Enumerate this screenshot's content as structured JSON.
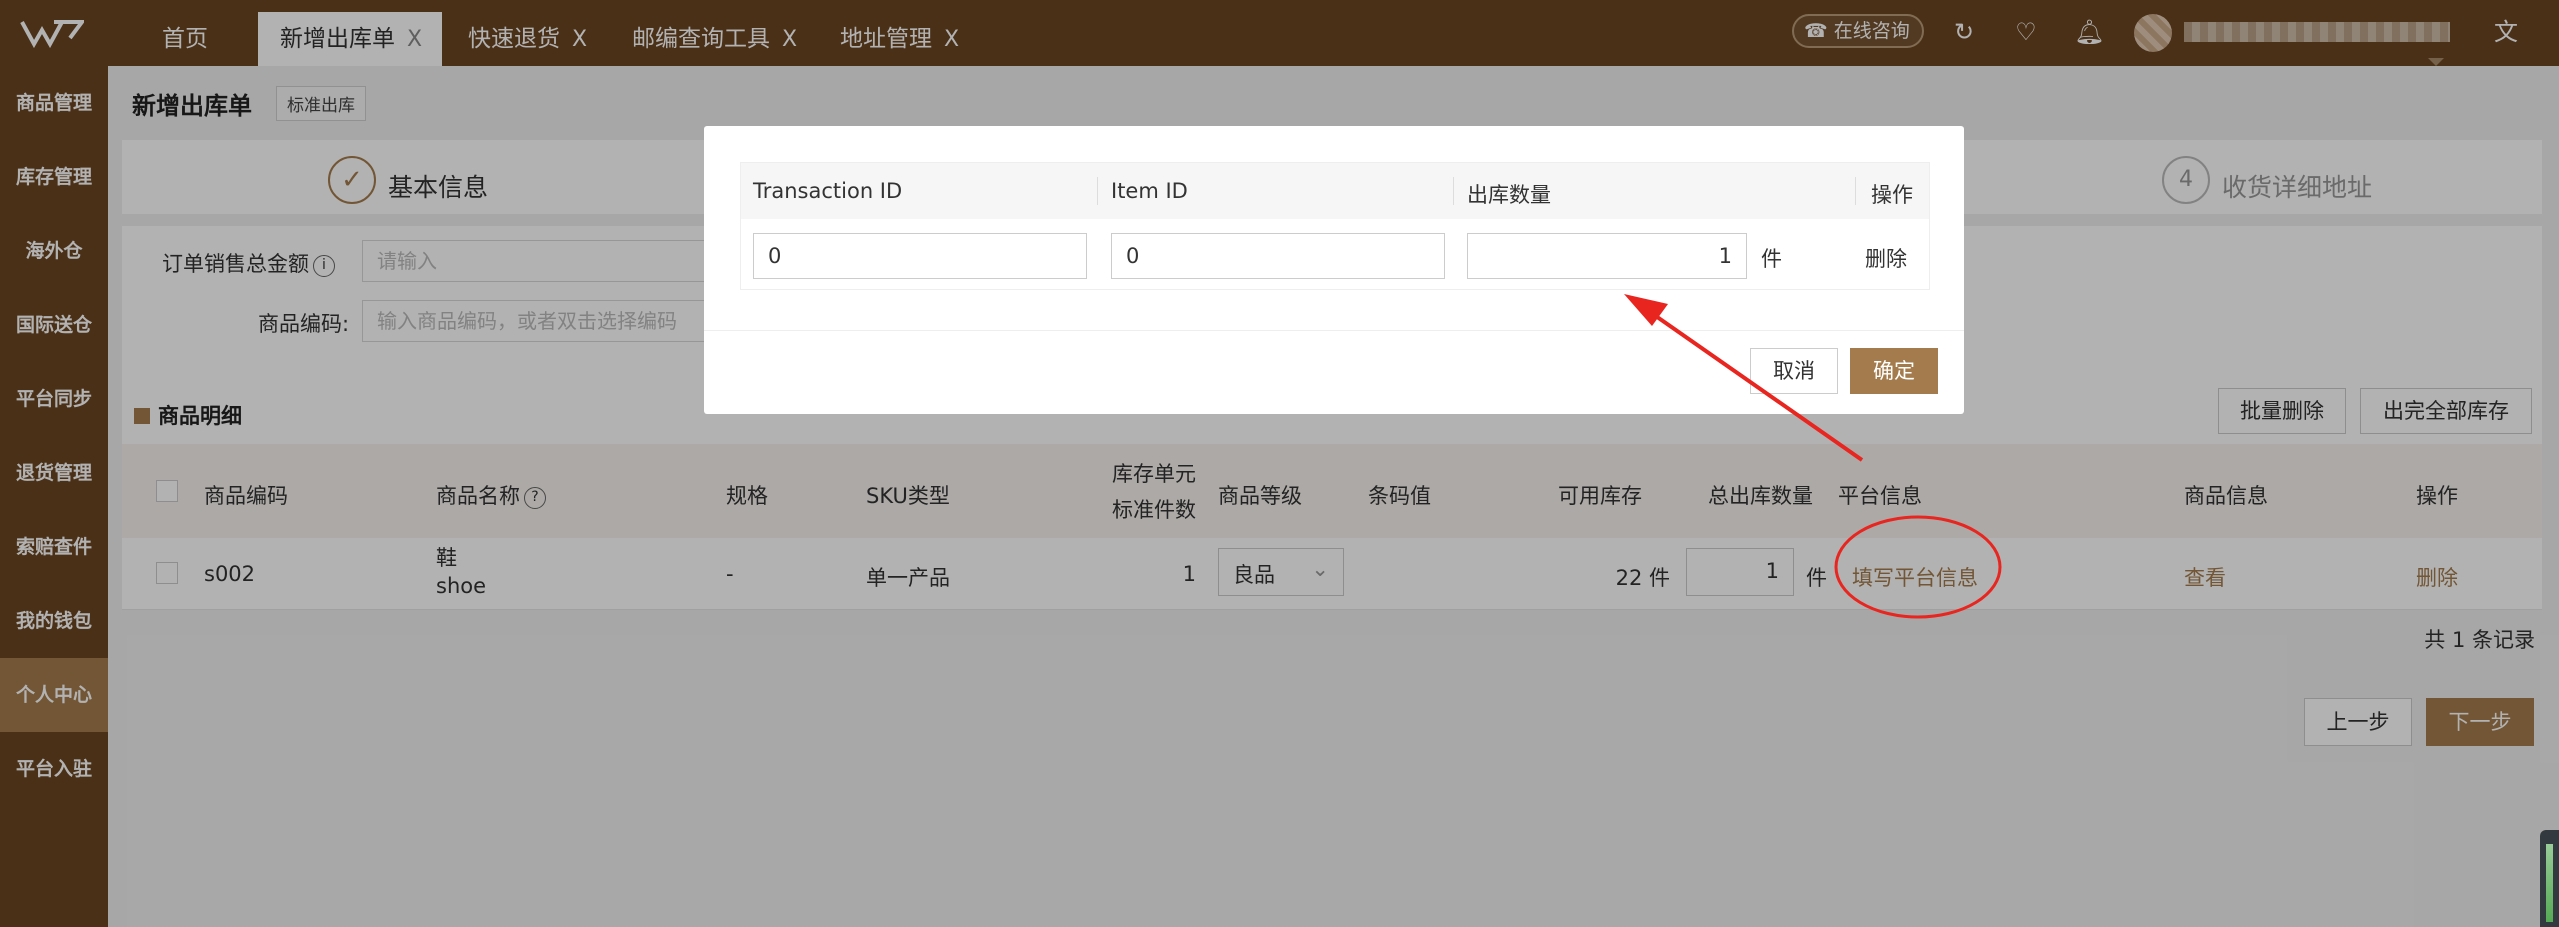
{
  "topbar": {
    "tabs": [
      {
        "label": "首页"
      },
      {
        "label": "新增出库单"
      },
      {
        "label": "快速退货"
      },
      {
        "label": "邮编查询工具"
      },
      {
        "label": "地址管理"
      }
    ],
    "close_glyph": "X",
    "consult_label": "在线咨询",
    "icons": [
      "refresh-icon",
      "heart-icon",
      "bell-icon",
      "translate-icon"
    ]
  },
  "sidebar": {
    "items": [
      {
        "label": "商品管理"
      },
      {
        "label": "库存管理"
      },
      {
        "label": "海外仓"
      },
      {
        "label": "国际送仓"
      },
      {
        "label": "平台同步"
      },
      {
        "label": "退货管理"
      },
      {
        "label": "索赔查件"
      },
      {
        "label": "我的钱包"
      },
      {
        "label": "个人中心"
      },
      {
        "label": "平台入驻"
      }
    ],
    "active_index": 8
  },
  "page": {
    "title": "新增出库单",
    "badge": "标准出库",
    "step1_label": "基本信息",
    "step4_number": "4",
    "step4_label": "收货详细地址",
    "form": {
      "amount_label": "订单销售总金额",
      "amount_placeholder": "请输入",
      "code_label": "商品编码:",
      "code_placeholder": "输入商品编码，或者双击选择编码"
    },
    "detail_title": "商品明细",
    "batch_delete": "批量删除",
    "ship_all": "出完全部库存",
    "table": {
      "headers": [
        "商品编码",
        "商品名称",
        "规格",
        "SKU类型",
        "库存单元",
        "标准件数",
        "商品等级",
        "条码值",
        "可用库存",
        "总出库数量",
        "平台信息",
        "商品信息",
        "操作"
      ],
      "row": {
        "code": "s002",
        "name_cn": "鞋",
        "name_en": "shoe",
        "spec": "-",
        "sku_type": "单一产品",
        "unit_count": "1",
        "grade": "良品",
        "barcode": "",
        "available": "22 件",
        "qty": "1",
        "qty_unit": "件",
        "platform_link": "填写平台信息",
        "view_link": "查看",
        "delete_link": "删除"
      }
    },
    "total": "共 1 条记录",
    "prev": "上一步",
    "next": "下一步"
  },
  "modal": {
    "headers": [
      "Transaction ID",
      "Item ID",
      "出库数量",
      "操作"
    ],
    "transaction_id": "0",
    "item_id": "0",
    "qty": "1",
    "qty_unit": "件",
    "delete": "删除",
    "cancel": "取消",
    "ok": "确定"
  },
  "colors": {
    "brand_brown": "#6b4521",
    "accent": "#a47b4c",
    "annotation_red": "#e8251f"
  }
}
